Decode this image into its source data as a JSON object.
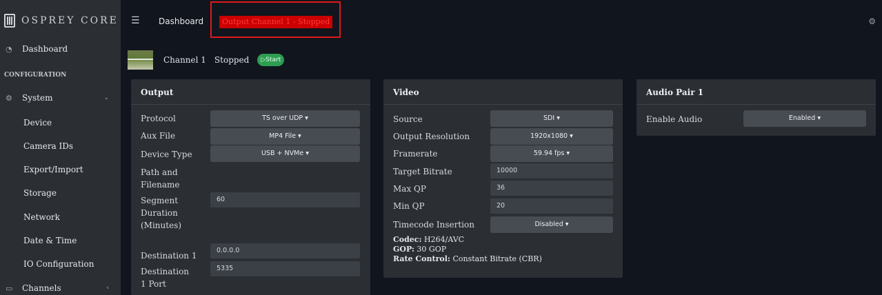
{
  "app": {
    "brand": "OSPREY CORE"
  },
  "header": {
    "breadcrumb": "Dashboard",
    "status": "Output Channel 1 - Stopped",
    "menu_icon": "hamburger-icon",
    "settings_icon": "gear-icon"
  },
  "sidebar": {
    "dashboard": "Dashboard",
    "section": "CONFIGURATION",
    "system": "System",
    "items": [
      "Device",
      "Camera IDs",
      "Export/Import",
      "Storage",
      "Network",
      "Date & Time",
      "IO Configuration"
    ],
    "channels": "Channels"
  },
  "channel": {
    "name": "Channel 1",
    "state": "Stopped",
    "start_label": "▷Start"
  },
  "output": {
    "title": "Output",
    "protocol_label": "Protocol",
    "protocol_value": "TS over UDP ▾",
    "aux_label": "Aux File",
    "aux_value": "MP4 File ▾",
    "device_label": "Device Type",
    "device_value": "USB + NVMe ▾",
    "path_label": "Path and Filename",
    "segment_label": "Segment Duration (Minutes)",
    "segment_value": "60",
    "dest_label": "Destination 1",
    "dest_value": "0.0.0.0",
    "port_label": "Destination 1 Port",
    "port_value": "5335"
  },
  "video": {
    "title": "Video",
    "source_label": "Source",
    "source_value": "SDI ▾",
    "resolution_label": "Output Resolution",
    "resolution_value": "1920x1080 ▾",
    "framerate_label": "Framerate",
    "framerate_value": "59.94 fps ▾",
    "bitrate_label": "Target Bitrate",
    "bitrate_value": "10000",
    "maxqp_label": "Max QP",
    "maxqp_value": "36",
    "minqp_label": "Min QP",
    "minqp_value": "20",
    "timecode_label": "Timecode Insertion",
    "timecode_value": "Disabled ▾",
    "codec_key": "Codec:",
    "codec_value": " H264/AVC",
    "gop_key": "GOP:",
    "gop_value": " 30 GOP",
    "rate_key": "Rate Control:",
    "rate_value": " Constant Bitrate (CBR)"
  },
  "audio": {
    "title": "Audio Pair 1",
    "enable_label": "Enable Audio",
    "enable_value": "Enabled ▾"
  }
}
